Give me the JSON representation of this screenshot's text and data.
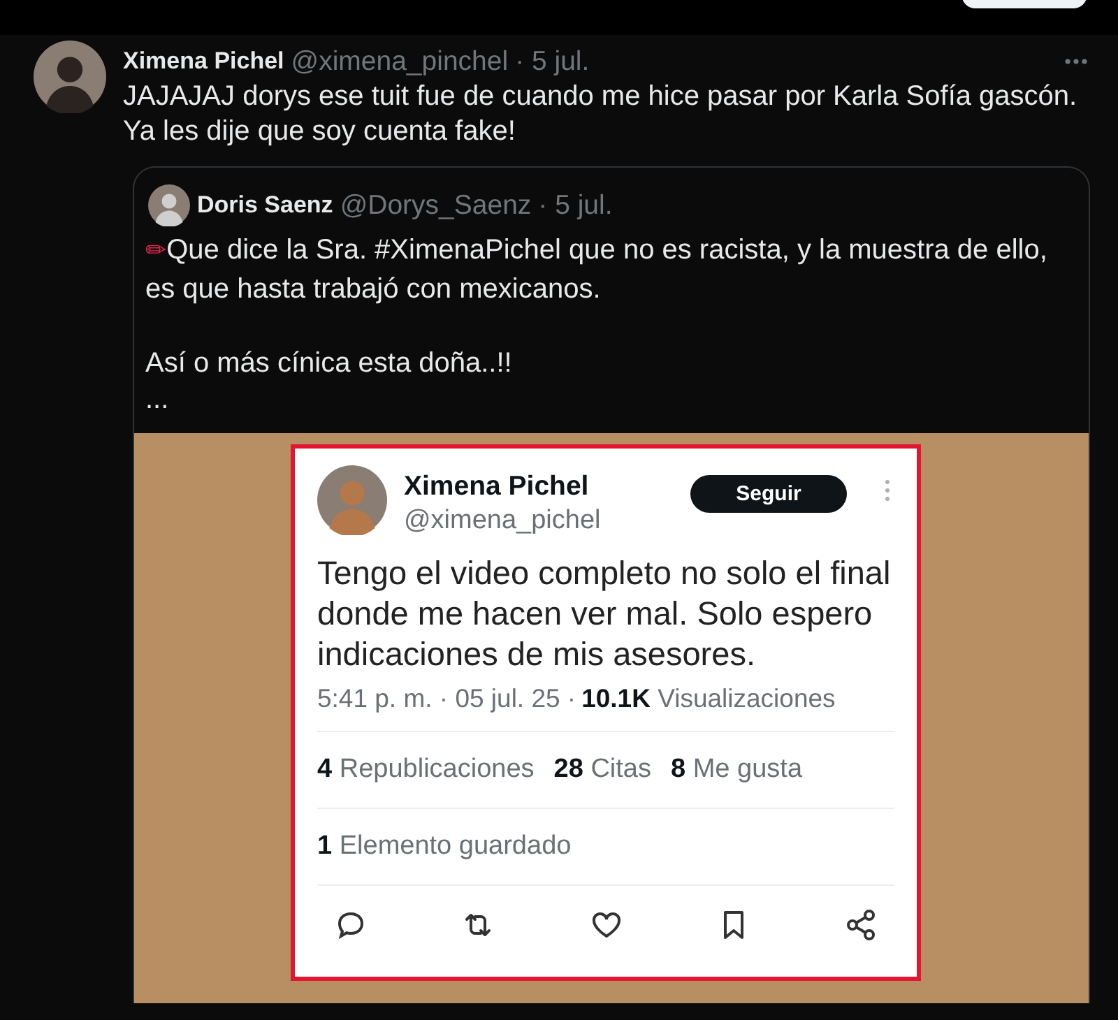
{
  "tweet": {
    "author": "Ximena Pichel",
    "handle": "@ximena_pinchel",
    "time": "· 5 jul.",
    "text": "JAJAJAJ dorys ese tuit fue de cuando me hice pasar por Karla Sofía gascón.\nYa les dije que soy cuenta fake!",
    "quote": {
      "author": "Doris Saenz",
      "handle": "@Dorys_Saenz",
      "time": "· 5 jul.",
      "emoji": "✏",
      "text": "Que dice la Sra. #XimenaPichel que no es racista, y la muestra de ello, es que hasta trabajó con mexicanos.\n\nAsí o más cínica esta doña..!!\n...",
      "screenshot": {
        "author": "Ximena Pichel",
        "handle": "@ximena_pichel",
        "follow_button": "Seguir",
        "text": "Tengo el video completo no solo el final donde me hacen ver mal. Solo espero indicaciones de mis asesores.",
        "timestamp": "5:41 p. m. · 05 jul. 25 ·",
        "views": "10.1K",
        "views_label": "Visualizaciones",
        "stats": [
          {
            "count": "4",
            "label": "Republicaciones"
          },
          {
            "count": "28",
            "label": "Citas"
          },
          {
            "count": "8",
            "label": "Me gusta"
          }
        ],
        "saved": {
          "count": "1",
          "label": "Elemento guardado"
        },
        "actions": [
          {
            "kind": "reply"
          },
          {
            "kind": "repost"
          },
          {
            "kind": "like"
          },
          {
            "kind": "bookmark"
          },
          {
            "kind": "share"
          }
        ]
      }
    }
  }
}
